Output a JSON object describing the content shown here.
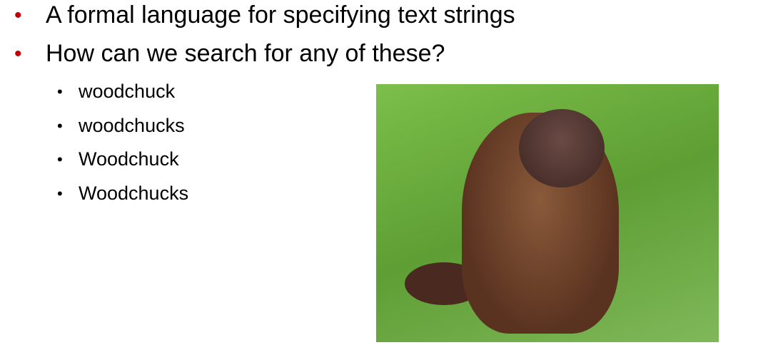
{
  "bullets": [
    {
      "text": "A formal language for specifying text strings"
    },
    {
      "text": "How can we search for any of these?",
      "children": [
        "woodchuck",
        "woodchucks",
        "Woodchuck",
        "Woodchucks"
      ]
    }
  ],
  "image": {
    "description_icon": "woodchuck-photo"
  },
  "colors": {
    "bullet": "#c00000"
  }
}
